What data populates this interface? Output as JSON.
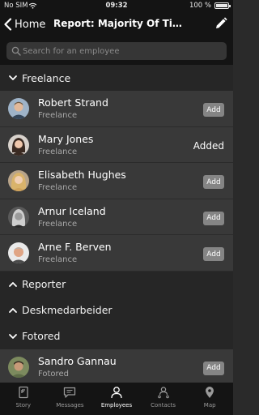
{
  "status": {
    "carrier": "No SIM",
    "time": "09:32",
    "battery": "100 %"
  },
  "nav": {
    "back_label": "Home",
    "title": "Report: Majority Of Time In Freelance"
  },
  "search": {
    "placeholder": "Search for an employee"
  },
  "sections": [
    {
      "title": "Freelance",
      "expanded": true
    },
    {
      "title": "Reporter",
      "expanded": false
    },
    {
      "title": "Deskmedarbeider",
      "expanded": false
    },
    {
      "title": "Fotored",
      "expanded": true
    }
  ],
  "employees": [
    {
      "name": "Robert Strand",
      "type": "Freelance",
      "action": "Add"
    },
    {
      "name": "Mary Jones",
      "type": "Freelance",
      "action": "Added"
    },
    {
      "name": "Elisabeth Hughes",
      "type": "Freelance",
      "action": "Add"
    },
    {
      "name": "Arnur Iceland",
      "type": "Freelance",
      "action": "Add"
    },
    {
      "name": "Arne F. Berven",
      "type": "Freelance",
      "action": "Add"
    },
    {
      "name": "Sandro Gannau",
      "type": "Fotored",
      "action": "Add"
    }
  ],
  "tabs": [
    {
      "label": "Story",
      "icon": "story-icon"
    },
    {
      "label": "Messages",
      "icon": "messages-icon"
    },
    {
      "label": "Employees",
      "icon": "employees-icon",
      "active": true
    },
    {
      "label": "Contacts",
      "icon": "contacts-icon"
    },
    {
      "label": "Map",
      "icon": "map-pin-icon"
    }
  ],
  "colors": {
    "background": "#2a2a2a",
    "bar": "#141414",
    "row": "#393939",
    "button": "#858585"
  }
}
